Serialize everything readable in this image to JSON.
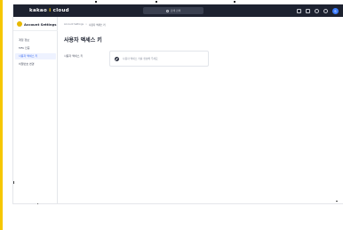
{
  "header": {
    "logo_prefix": "kakao ",
    "logo_highlight": "i",
    "logo_suffix": " cloud",
    "search_placeholder": "검색 검색",
    "avatar_initial": "S"
  },
  "sidebar": {
    "title": "Account Settings",
    "items": [
      {
        "label": "계정 정보",
        "active": false
      },
      {
        "label": "MFA 인증",
        "active": false
      },
      {
        "label": "사용자 액세스 키",
        "active": true
      },
      {
        "label": "비밀번호 변경",
        "active": false
      }
    ]
  },
  "main": {
    "breadcrumb": {
      "root": "Account Settings",
      "separator": ">",
      "current": "사용자 액세스 키"
    },
    "title": "사용자 액세스 키",
    "row_label": "사용자 액세스 키",
    "card_text": "사용자 액세스 키를 생성해 주세요"
  },
  "colors": {
    "accent": "#f6c700",
    "header_bg": "#1d2230",
    "active_item": "#3b6bf0"
  }
}
